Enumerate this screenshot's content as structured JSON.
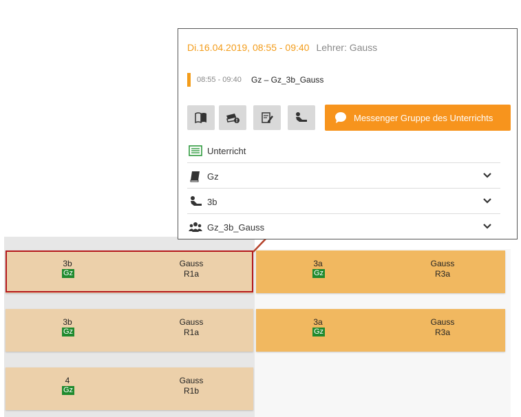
{
  "popup": {
    "date_time": "Di.16.04.2019, 08:55 - 09:40",
    "teacher": "Lehrer: Gauss",
    "lesson_time": "08:55 - 09:40",
    "lesson_name": "Gz – Gz_3b_Gauss",
    "messenger_label": "Messenger Gruppe des Unterrichts",
    "sections": [
      {
        "label": "Unterricht",
        "icon": "lesson-table-icon"
      },
      {
        "label": "Gz",
        "icon": "book-icon"
      },
      {
        "label": "3b",
        "icon": "student-desk-icon"
      },
      {
        "label": "Gz_3b_Gauss",
        "icon": "group-icon"
      }
    ],
    "buttons": [
      "class-register-icon",
      "homework-icon",
      "edit-notes-icon",
      "student-seat-icon"
    ]
  },
  "timetable": {
    "cells": [
      {
        "class": "3b",
        "subject": "Gz",
        "teacher": "Gauss",
        "room": "R1a"
      },
      {
        "class": "3a",
        "subject": "Gz",
        "teacher": "Gauss",
        "room": "R3a"
      },
      {
        "class": "3b",
        "subject": "Gz",
        "teacher": "Gauss",
        "room": "R1a"
      },
      {
        "class": "3a",
        "subject": "Gz",
        "teacher": "Gauss",
        "room": "R3a"
      },
      {
        "class": "4",
        "subject": "Gz",
        "teacher": "Gauss",
        "room": "R1b"
      }
    ]
  },
  "colors": {
    "accent": "#f39c1a",
    "messenger": "#f7941d",
    "cell_light": "#ecd0aa",
    "cell_dark": "#f1b860",
    "subject_badge": "#1f8a2e",
    "highlight_border": "#b4191c"
  }
}
